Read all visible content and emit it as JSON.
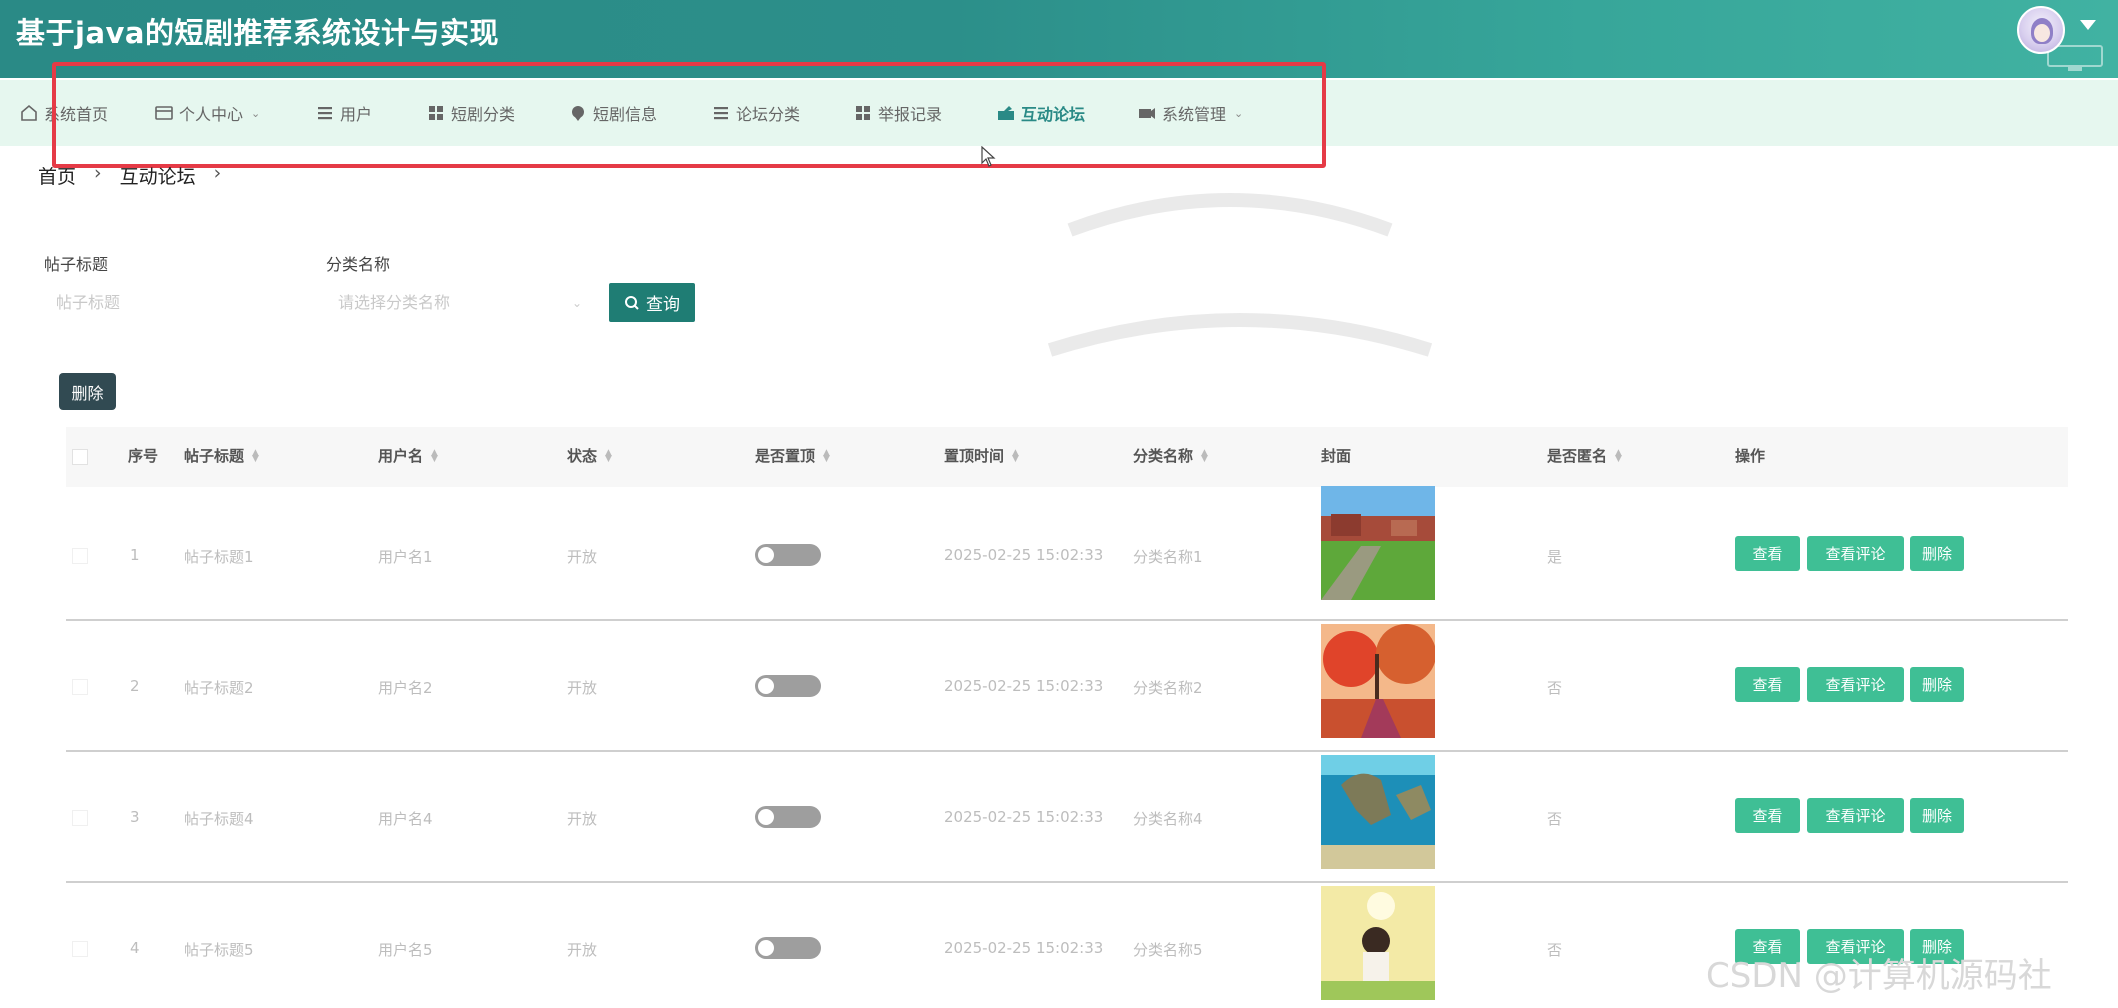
{
  "header": {
    "title": "基于java的短剧推荐系统设计与实现"
  },
  "nav": {
    "items": [
      {
        "label": "系统首页",
        "icon": "home-icon"
      },
      {
        "label": "个人中心",
        "icon": "profile-icon",
        "dropdown": true
      },
      {
        "label": "用户",
        "icon": "list-icon"
      },
      {
        "label": "短剧分类",
        "icon": "grid-icon"
      },
      {
        "label": "短剧信息",
        "icon": "pin-icon"
      },
      {
        "label": "论坛分类",
        "icon": "list-icon"
      },
      {
        "label": "举报记录",
        "icon": "grid-icon"
      },
      {
        "label": "互动论坛",
        "icon": "forum-icon",
        "active": true
      },
      {
        "label": "系统管理",
        "icon": "settings-icon",
        "dropdown": true
      }
    ]
  },
  "breadcrumb": {
    "home": "首页",
    "current": "互动论坛",
    "sep": "›"
  },
  "search": {
    "title_label": "帖子标题",
    "title_placeholder": "帖子标题",
    "category_label": "分类名称",
    "category_placeholder": "请选择分类名称",
    "query_label": "查询"
  },
  "toolbar": {
    "delete_label": "删除"
  },
  "table": {
    "headers": {
      "index": "序号",
      "title": "帖子标题",
      "username": "用户名",
      "status": "状态",
      "pinned": "是否置顶",
      "pin_time": "置顶时间",
      "category": "分类名称",
      "cover": "封面",
      "anonymous": "是否匿名",
      "actions": "操作"
    },
    "rows": [
      {
        "index": "1",
        "title": "帖子标题1",
        "username": "用户名1",
        "status": "开放",
        "pinned": false,
        "pin_time": "2025-02-25 15:02:33",
        "category": "分类名称1",
        "anonymous": "是"
      },
      {
        "index": "2",
        "title": "帖子标题2",
        "username": "用户名2",
        "status": "开放",
        "pinned": false,
        "pin_time": "2025-02-25 15:02:33",
        "category": "分类名称2",
        "anonymous": "否"
      },
      {
        "index": "3",
        "title": "帖子标题4",
        "username": "用户名4",
        "status": "开放",
        "pinned": false,
        "pin_time": "2025-02-25 15:02:33",
        "category": "分类名称4",
        "anonymous": "否"
      },
      {
        "index": "4",
        "title": "帖子标题5",
        "username": "用户名5",
        "status": "开放",
        "pinned": false,
        "pin_time": "2025-02-25 15:02:33",
        "category": "分类名称5",
        "anonymous": "否"
      }
    ],
    "actions": {
      "view": "查看",
      "view_comments": "查看评论",
      "delete": "删除"
    }
  },
  "watermark": "CSDN @计算机源码社",
  "colors": {
    "header": "#2a8a86",
    "nav_bg": "#e6f7ef",
    "accent": "#3fbf95",
    "highlight": "#e53a46"
  }
}
